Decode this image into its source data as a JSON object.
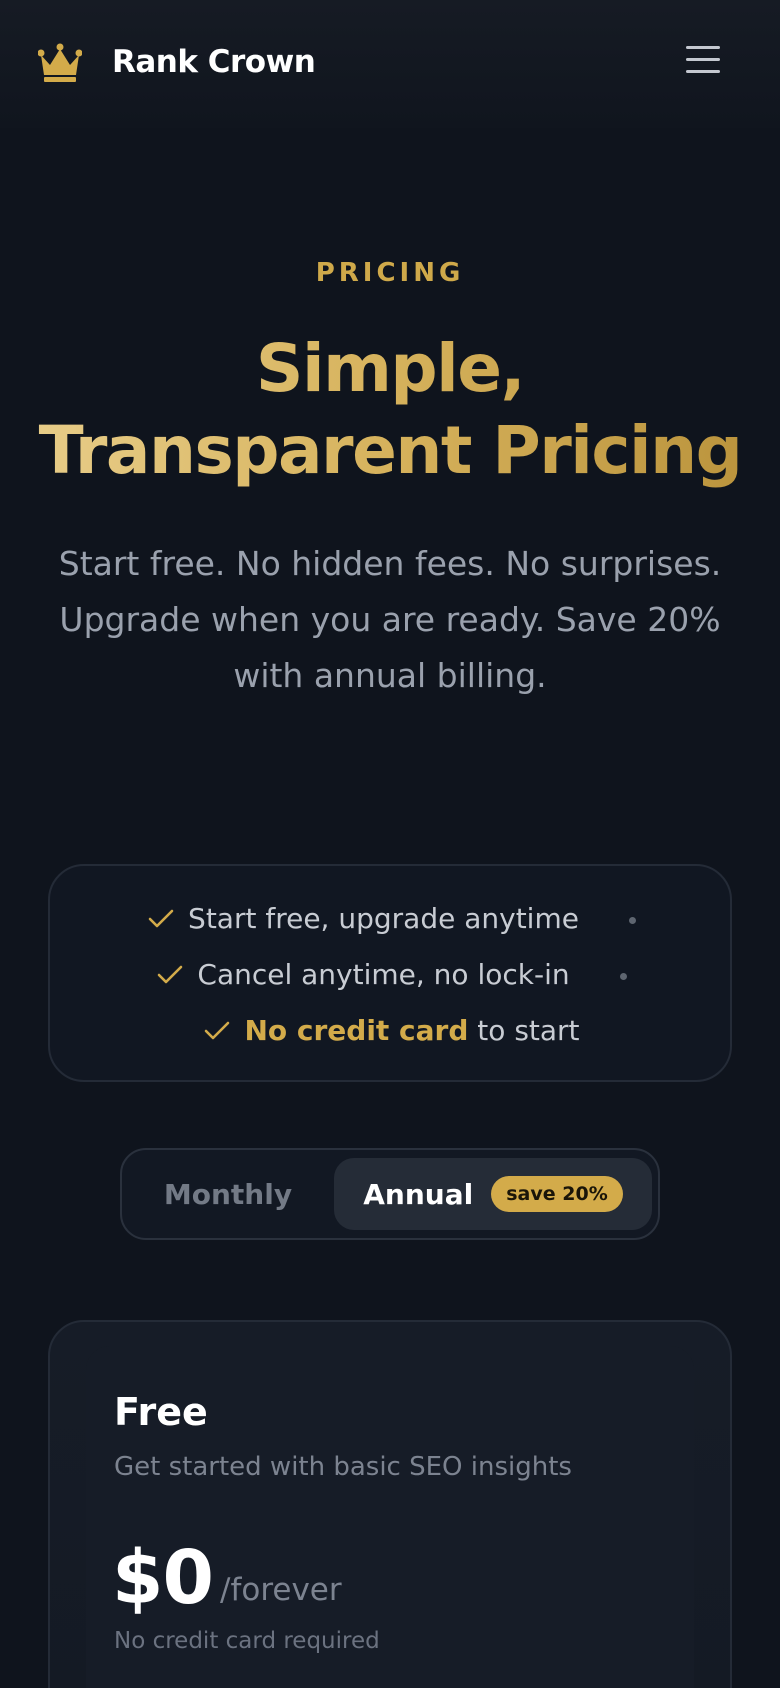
{
  "header": {
    "brand": "Rank Crown",
    "logo_icon": "crown-icon",
    "menu_icon": "hamburger-menu-icon"
  },
  "hero": {
    "eyebrow": "PRICING",
    "title_line1": "Simple,",
    "title_line2": "Transparent Pricing",
    "subtitle_line1": "Start free. No hidden fees. No surprises.",
    "subtitle_line2": "Upgrade when you are ready. Save 20%",
    "subtitle_line3": "with annual billing."
  },
  "features": {
    "items": [
      {
        "text": "Start free, upgrade anytime"
      },
      {
        "text": "Cancel anytime, no lock-in"
      },
      {
        "highlight": "No credit card",
        "rest": " to start"
      }
    ],
    "check_icon": "check-icon"
  },
  "billing_toggle": {
    "monthly": "Monthly",
    "annual": "Annual",
    "badge": "save 20%",
    "selected": "Annual"
  },
  "plan": {
    "name": "Free",
    "description": "Get started with basic SEO insights",
    "price": "$0",
    "period": "/forever",
    "note": "No credit card required"
  },
  "colors": {
    "background": "#0f141d",
    "gold": "#d3ab4a",
    "muted": "#9aa1ad"
  }
}
